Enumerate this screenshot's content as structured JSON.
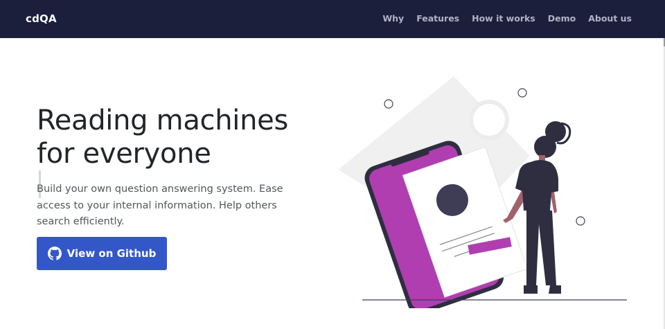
{
  "navbar": {
    "brand": "cdQA",
    "links": [
      "Why",
      "Features",
      "How it works",
      "Demo",
      "About us"
    ]
  },
  "hero": {
    "headline_line1": "Reading machines",
    "headline_line2": "for everyone",
    "subtitle": "Build your own question answering system. Ease access to your internal information. Help others search efficiently.",
    "button_label": "View on Github",
    "button_icon": "github-icon"
  },
  "colors": {
    "navbar_bg": "#1b1f3c",
    "button_bg": "#3457c8",
    "accent_purple": "#b03eb0",
    "figure_dark": "#2f2e41"
  }
}
